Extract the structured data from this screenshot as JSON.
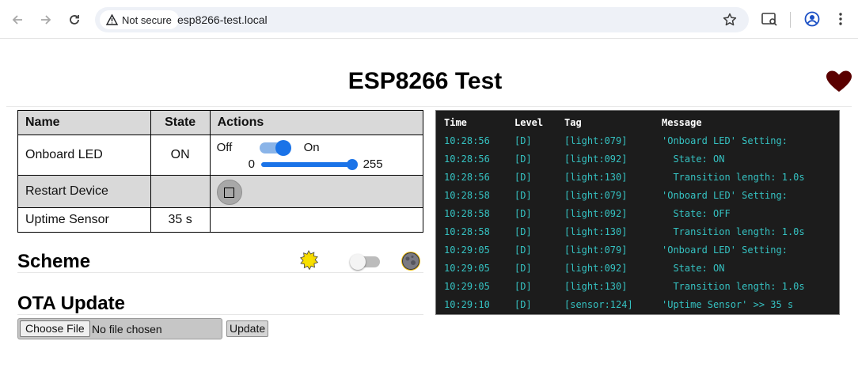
{
  "browser": {
    "security_label": "Not secure",
    "url": "esp8266-test.local"
  },
  "page": {
    "title": "ESP8266 Test"
  },
  "entities": {
    "headers": [
      "Name",
      "State",
      "Actions"
    ],
    "light": {
      "name": "Onboard LED",
      "state": "ON",
      "off_label": "Off",
      "on_label": "On",
      "toggle_on": true,
      "brightness_min": "0",
      "brightness_max": "255",
      "brightness_value": 255
    },
    "restart": {
      "name": "Restart Device",
      "state": ""
    },
    "uptime": {
      "name": "Uptime Sensor",
      "state": "35 s"
    }
  },
  "scheme": {
    "title": "Scheme",
    "sun_icon": "sun-icon",
    "moon_icon": "moon-icon",
    "dark_mode": false
  },
  "ota": {
    "title": "OTA Update",
    "choose_label": "Choose File",
    "file_status": "No file chosen",
    "update_label": "Update"
  },
  "log": {
    "headers": {
      "time": "Time",
      "level": "Level",
      "tag": "Tag",
      "message": "Message"
    },
    "rows": [
      {
        "time": "10:28:56",
        "level": "[D]",
        "tag": "[light:079]",
        "message": "'Onboard LED' Setting:"
      },
      {
        "time": "10:28:56",
        "level": "[D]",
        "tag": "[light:092]",
        "message": "  State: ON"
      },
      {
        "time": "10:28:56",
        "level": "[D]",
        "tag": "[light:130]",
        "message": "  Transition length: 1.0s"
      },
      {
        "time": "10:28:58",
        "level": "[D]",
        "tag": "[light:079]",
        "message": "'Onboard LED' Setting:"
      },
      {
        "time": "10:28:58",
        "level": "[D]",
        "tag": "[light:092]",
        "message": "  State: OFF"
      },
      {
        "time": "10:28:58",
        "level": "[D]",
        "tag": "[light:130]",
        "message": "  Transition length: 1.0s"
      },
      {
        "time": "10:29:05",
        "level": "[D]",
        "tag": "[light:079]",
        "message": "'Onboard LED' Setting:"
      },
      {
        "time": "10:29:05",
        "level": "[D]",
        "tag": "[light:092]",
        "message": "  State: ON"
      },
      {
        "time": "10:29:05",
        "level": "[D]",
        "tag": "[light:130]",
        "message": "  Transition length: 1.0s"
      },
      {
        "time": "10:29:10",
        "level": "[D]",
        "tag": "[sensor:124]",
        "message": "'Uptime Sensor' >> 35 s"
      }
    ]
  },
  "colors": {
    "accent": "#1a73e8",
    "log_text": "#35c2c2",
    "log_bg": "#1c1c1c",
    "heart": "#5a0000"
  }
}
